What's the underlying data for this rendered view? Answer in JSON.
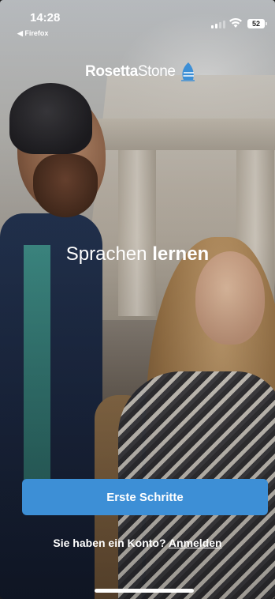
{
  "status_bar": {
    "time": "14:28",
    "back_app": "◀ Firefox",
    "battery": "52"
  },
  "logo": {
    "part1": "Rosetta",
    "part2": "Stone"
  },
  "headline": {
    "light": "Sprachen",
    "bold": "lernen"
  },
  "cta": {
    "label": "Erste Schritte"
  },
  "account": {
    "prompt": "Sie haben ein Konto?",
    "link": "Anmelden"
  },
  "colors": {
    "accent": "#3d8fd6"
  }
}
